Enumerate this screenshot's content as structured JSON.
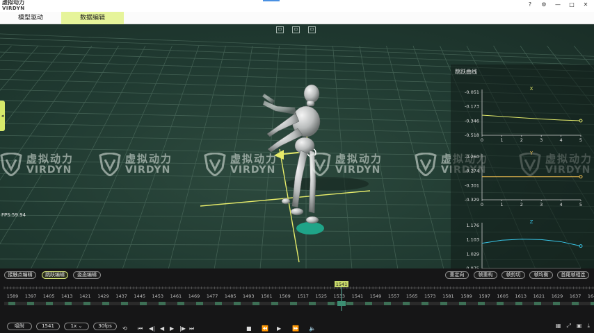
{
  "app": {
    "logo_cn": "虚拟动力",
    "logo_en": "VIRDYN",
    "window_buttons": [
      "?",
      "⚙",
      "—",
      "□",
      "✕"
    ]
  },
  "tabs": [
    {
      "label": "模型驱动",
      "active": false
    },
    {
      "label": "数据编辑",
      "active": true
    }
  ],
  "viewport": {
    "fps": "FPS:59.94",
    "watermark_cn": "虚拟动力",
    "watermark_en": "VIRDYN",
    "view_buttons": [
      "front-view-icon",
      "side-view-icon",
      "top-view-icon"
    ]
  },
  "curve_panel": {
    "title": "跳跃曲线",
    "charts": [
      {
        "axis": "X",
        "yticks": [
          "-0.051",
          "-0.173",
          "-0.346",
          "-0.518"
        ],
        "xticks": [
          "0",
          "1",
          "2",
          "3",
          "4",
          "5"
        ],
        "color": "#e3ea6a"
      },
      {
        "axis": "Y",
        "yticks": [
          "-0.260",
          "-0.274",
          "-0.301",
          "-0.329"
        ],
        "xticks": [
          "0",
          "1",
          "2",
          "3",
          "4",
          "5"
        ],
        "color": "#f0c050"
      },
      {
        "axis": "Z",
        "yticks": [
          "1.176",
          "1.103",
          "1.029",
          "0.975"
        ],
        "xticks": [
          "0",
          "1",
          "2",
          "3",
          "4",
          "5"
        ],
        "color": "#39c6e8"
      }
    ]
  },
  "chart_data": [
    {
      "type": "line",
      "title": "X",
      "x": [
        0,
        1,
        2,
        3,
        4,
        5
      ],
      "values": [
        -0.3,
        -0.314,
        -0.328,
        -0.341,
        -0.352,
        -0.36
      ],
      "ylim": [
        -0.518,
        -0.051
      ]
    },
    {
      "type": "line",
      "title": "Y",
      "x": [
        0,
        1,
        2,
        3,
        4,
        5
      ],
      "values": [
        -0.292,
        -0.292,
        -0.292,
        -0.292,
        -0.292,
        -0.292
      ],
      "ylim": [
        -0.329,
        -0.26
      ]
    },
    {
      "type": "line",
      "title": "Z",
      "x": [
        0,
        1,
        2,
        3,
        4,
        5
      ],
      "values": [
        1.093,
        1.107,
        1.112,
        1.11,
        1.1,
        1.08
      ],
      "ylim": [
        0.975,
        1.176
      ]
    }
  ],
  "toolbar": {
    "left_buttons": [
      "接触点编辑",
      "跳跃编辑",
      "姿态编辑"
    ],
    "active_left": 1,
    "right_buttons": [
      "重定向",
      "帧重构",
      "帧剪切",
      "帧均衡",
      "首尾帧相连"
    ]
  },
  "timeline": {
    "current_frame": "1541",
    "ticks": [
      "1589",
      "1397",
      "1405",
      "1413",
      "1421",
      "1429",
      "1437",
      "1445",
      "1453",
      "1461",
      "1469",
      "1477",
      "1485",
      "1493",
      "1501",
      "1509",
      "1517",
      "1525",
      "1533",
      "1541",
      "1549",
      "1557",
      "1565",
      "1573",
      "1581",
      "1589",
      "1597",
      "1605",
      "1613",
      "1621",
      "1629",
      "1637",
      "1645",
      "165"
    ],
    "range_start": "1389",
    "range_end": "1653"
  },
  "controls": {
    "mode": "吸附",
    "frame": "1541",
    "speed": "1x",
    "fps": "30fps"
  }
}
